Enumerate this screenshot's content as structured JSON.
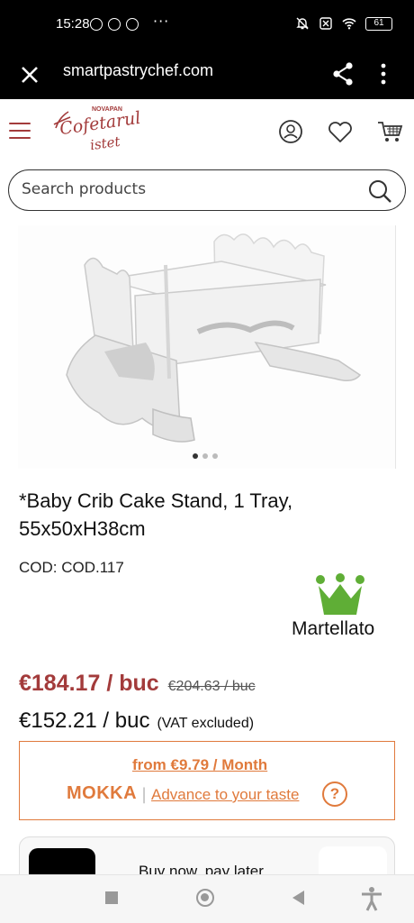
{
  "status_bar": {
    "time": "15:28",
    "battery": "61"
  },
  "browser": {
    "url": "smartpastrychef.com"
  },
  "header": {
    "logo_top": "NOVAPAN",
    "logo_line1": "Cofetarul",
    "logo_line2": "istet"
  },
  "search": {
    "placeholder": "Search products"
  },
  "product": {
    "title": "*Baby Crib Cake Stand, 1 Tray, 55x50xH38cm",
    "code": "COD: COD.117",
    "brand": "Martellato",
    "price_gross": "€184.17 / buc",
    "price_old": "€204.63 / buc",
    "price_net": "€152.21 / buc",
    "vat_note": "(VAT excluded)"
  },
  "mokka": {
    "from_text": "from €9.79 / Month",
    "logo": "MOKKA",
    "separator": "|",
    "advance_text": "Advance to your taste",
    "help": "?"
  },
  "bnpl": {
    "text": "Buy now, pay later"
  },
  "colors": {
    "brand": "#a33b3b",
    "mokka": "#e07a3c",
    "crown": "#5fae36"
  }
}
